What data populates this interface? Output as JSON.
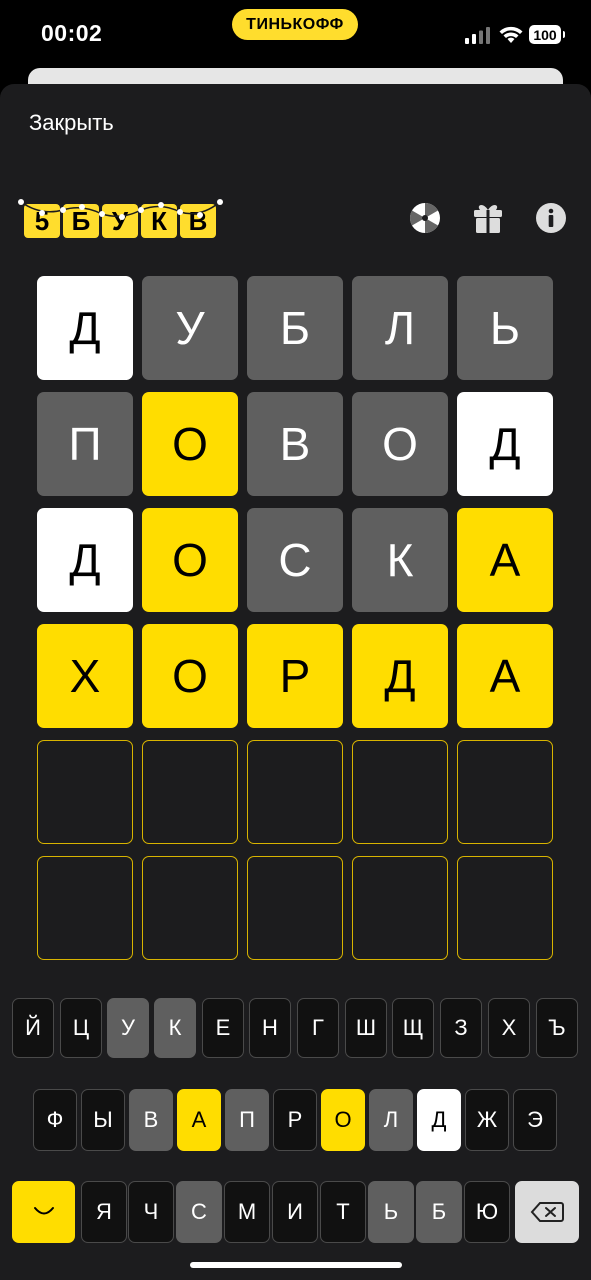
{
  "status_bar": {
    "time": "00:02",
    "brand": "ТИНЬКОФФ",
    "battery": "100"
  },
  "header": {
    "close_label": "Закрыть",
    "logo_letters": [
      "5",
      "Б",
      "У",
      "К",
      "В"
    ],
    "icons": [
      "wheel-icon",
      "gift-icon",
      "info-icon"
    ]
  },
  "colors": {
    "yellow": "#ffdd00",
    "gray": "#5f5f5f",
    "white": "#ffffff",
    "sheet_bg": "#1c1c1e"
  },
  "grid": {
    "rows": [
      [
        {
          "letter": "Д",
          "state": "white"
        },
        {
          "letter": "У",
          "state": "gray"
        },
        {
          "letter": "Б",
          "state": "gray"
        },
        {
          "letter": "Л",
          "state": "gray"
        },
        {
          "letter": "Ь",
          "state": "gray"
        }
      ],
      [
        {
          "letter": "П",
          "state": "gray"
        },
        {
          "letter": "О",
          "state": "yellow"
        },
        {
          "letter": "В",
          "state": "gray"
        },
        {
          "letter": "О",
          "state": "gray"
        },
        {
          "letter": "Д",
          "state": "white"
        }
      ],
      [
        {
          "letter": "Д",
          "state": "white"
        },
        {
          "letter": "О",
          "state": "yellow"
        },
        {
          "letter": "С",
          "state": "gray"
        },
        {
          "letter": "К",
          "state": "gray"
        },
        {
          "letter": "А",
          "state": "yellow"
        }
      ],
      [
        {
          "letter": "Х",
          "state": "yellow"
        },
        {
          "letter": "О",
          "state": "yellow"
        },
        {
          "letter": "Р",
          "state": "yellow"
        },
        {
          "letter": "Д",
          "state": "yellow"
        },
        {
          "letter": "А",
          "state": "yellow"
        }
      ],
      [
        {
          "letter": "",
          "state": "empty"
        },
        {
          "letter": "",
          "state": "empty"
        },
        {
          "letter": "",
          "state": "empty"
        },
        {
          "letter": "",
          "state": "empty"
        },
        {
          "letter": "",
          "state": "empty"
        }
      ],
      [
        {
          "letter": "",
          "state": "empty"
        },
        {
          "letter": "",
          "state": "empty"
        },
        {
          "letter": "",
          "state": "empty"
        },
        {
          "letter": "",
          "state": "empty"
        },
        {
          "letter": "",
          "state": "empty"
        }
      ]
    ]
  },
  "keyboard": {
    "row1": [
      {
        "key": "Й",
        "state": "default"
      },
      {
        "key": "Ц",
        "state": "default"
      },
      {
        "key": "У",
        "state": "gray"
      },
      {
        "key": "К",
        "state": "gray"
      },
      {
        "key": "Е",
        "state": "default"
      },
      {
        "key": "Н",
        "state": "default"
      },
      {
        "key": "Г",
        "state": "default"
      },
      {
        "key": "Ш",
        "state": "default"
      },
      {
        "key": "Щ",
        "state": "default"
      },
      {
        "key": "З",
        "state": "default"
      },
      {
        "key": "Х",
        "state": "default"
      },
      {
        "key": "Ъ",
        "state": "default"
      }
    ],
    "row2": [
      {
        "key": "Ф",
        "state": "default"
      },
      {
        "key": "Ы",
        "state": "default"
      },
      {
        "key": "В",
        "state": "gray"
      },
      {
        "key": "А",
        "state": "yellow"
      },
      {
        "key": "П",
        "state": "gray"
      },
      {
        "key": "Р",
        "state": "default"
      },
      {
        "key": "О",
        "state": "yellow"
      },
      {
        "key": "Л",
        "state": "gray"
      },
      {
        "key": "Д",
        "state": "white"
      },
      {
        "key": "Ж",
        "state": "default"
      },
      {
        "key": "Э",
        "state": "default"
      }
    ],
    "row3": [
      {
        "key": "Я",
        "state": "default"
      },
      {
        "key": "Ч",
        "state": "default"
      },
      {
        "key": "С",
        "state": "gray"
      },
      {
        "key": "М",
        "state": "default"
      },
      {
        "key": "И",
        "state": "default"
      },
      {
        "key": "Т",
        "state": "default"
      },
      {
        "key": "Ь",
        "state": "gray"
      },
      {
        "key": "Б",
        "state": "gray"
      },
      {
        "key": "Ю",
        "state": "default"
      }
    ]
  }
}
